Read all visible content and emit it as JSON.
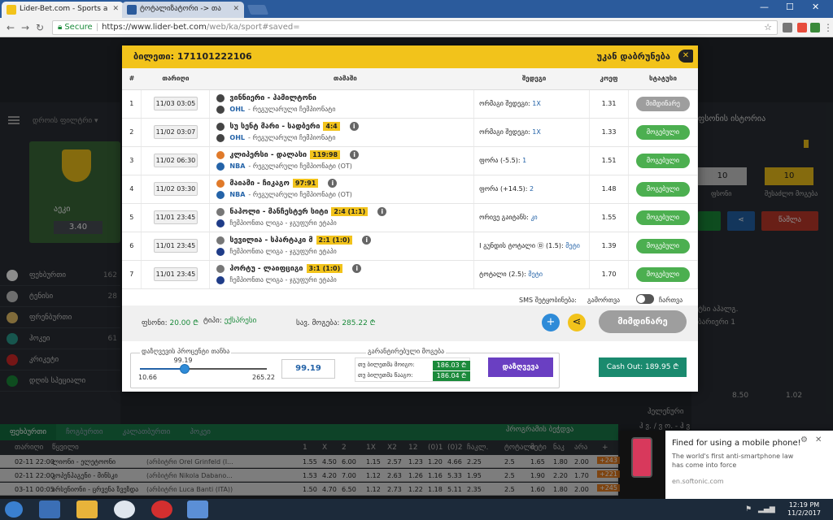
{
  "browser": {
    "tabs": [
      {
        "label": "Lider-Bet.com - Sports a",
        "favicon_color": "#f2c31b"
      },
      {
        "label": "ტოტალიზატორი -> თა",
        "favicon_color": "#2b5b9c"
      }
    ],
    "secure_label": "Secure",
    "url_domain": "https://www.lider-bet.com",
    "url_path": "/web/ka/sport#saved="
  },
  "colors": {
    "brand_yellow": "#f2c31b",
    "won_green": "#4caf50",
    "status_gray": "#9e9e9e",
    "calc_purple": "#6a3fc2",
    "cashout_teal": "#1a8a6e"
  },
  "background": {
    "filter_label": "დროის ფილტრი ▾",
    "promo_team": "აეკი",
    "promo_odd": "3.40",
    "sports": [
      {
        "name": "ფეხბურთი",
        "count": "162",
        "color": "#ffffff"
      },
      {
        "name": "ტენისი",
        "count": "28",
        "color": "#c8c8c8"
      },
      {
        "name": "ფრენბურთი",
        "count": "",
        "color": "#e9c46a"
      },
      {
        "name": "ჰოკეი",
        "count": "61",
        "color": "#2a9d8f"
      },
      {
        "name": "კრიკეტი",
        "count": "",
        "color": "#d62828"
      },
      {
        "name": "დღის სპეციალი",
        "count": "",
        "color": "#1a8a3a"
      }
    ],
    "right": {
      "title": "ფსონის ისტორია",
      "box1": "10",
      "box2": "10",
      "box1_label": "ფსონი",
      "box2_label": "შესაძლო მოგება",
      "delete_label": "წაშლა",
      "items": [
        "ტსი აჰალგ.",
        "ბარიერი 1",
        "ჰელენური",
        "ჰ ვ. / ვ ო. - ჰ ვ"
      ],
      "odds": [
        "8.50",
        "1.02"
      ]
    },
    "bottom_tabs": [
      {
        "label": "ფეხბურთი",
        "active": true
      },
      {
        "label": "ჩოგბურთი",
        "active": false
      },
      {
        "label": "კალათბურთი",
        "active": false
      },
      {
        "label": "ჰოკეი",
        "active": false
      }
    ],
    "program_label": "პროგრამის ბეჭდვა",
    "table_cols": [
      "თარიღი",
      "წყვილი",
      "1",
      "X",
      "2",
      "1X",
      "X2",
      "12",
      "(0)1",
      "(0)2",
      "ჩაკლ.",
      "ტოტალი",
      "მეტი",
      "ნაკ",
      "არა",
      "+"
    ],
    "rows": [
      {
        "date": "02-11 22:00",
        "pair": "ლიონი - ელეტოონი",
        "ref": "(არბიტრი Orel Grinfeld (I...",
        "odds": [
          "1.55",
          "4.50",
          "6.00",
          "1.15",
          "2.57",
          "1.23",
          "1.20",
          "4.66",
          "2.25",
          "2.5",
          "1.65",
          "1.80",
          "2.00"
        ],
        "more": "+243"
      },
      {
        "date": "02-11 22:00",
        "pair": "კოპენჰაგენი - მინსკი",
        "ref": "(არბიტრი Nikola Dabano...",
        "odds": [
          "1.53",
          "4.20",
          "7.00",
          "1.12",
          "2.63",
          "1.26",
          "1.16",
          "5.33",
          "1.95",
          "2.5",
          "1.90",
          "2.20",
          "1.70"
        ],
        "more": "+221"
      },
      {
        "date": "03-11 00:05",
        "pair": "არსენიონი - ცრვენა ზვეზდა",
        "ref": "(არბიტრი Luca Banti (ITA))",
        "odds": [
          "1.50",
          "4.70",
          "6.50",
          "1.12",
          "2.73",
          "1.22",
          "1.18",
          "5.11",
          "2.35",
          "2.5",
          "1.60",
          "1.80",
          "2.00"
        ],
        "more": "+245"
      }
    ]
  },
  "modal": {
    "ticket_label": "ბილეთი: 171101222106",
    "back_label": "უკან დაბრუნება",
    "columns": [
      "#",
      "თარიღი",
      "თამაში",
      "შედეგი",
      "კოეფ",
      "სტატუსი"
    ],
    "bets": [
      {
        "num": "1",
        "date": "11/03 03:05",
        "sport_color": "#444444",
        "teams": "ვინნიერი - ჰამილტონი",
        "score": "",
        "info": false,
        "league": "OHL",
        "league_color": "#444444",
        "tournament": "- რეგულარული ჩემპიონატი",
        "bet_label": "ორმაგი შედეგი:",
        "bet_value": "1X",
        "odd": "1.31",
        "status": "მიმდინარე",
        "status_type": "pending"
      },
      {
        "num": "2",
        "date": "11/02 03:07",
        "sport_color": "#444444",
        "teams": "სუ სენტ მარი - სადბერი",
        "score": "4:4",
        "info": true,
        "league": "OHL",
        "league_color": "#444444",
        "tournament": "- რეგულარული ჩემპიონატი",
        "bet_label": "ორმაგი შედეგი:",
        "bet_value": "1X",
        "odd": "1.33",
        "status": "მოგებული",
        "status_type": "won"
      },
      {
        "num": "3",
        "date": "11/02 06:30",
        "sport_color": "#e07a2a",
        "teams": "კლიპერსი - დალასი",
        "score": "119:98",
        "info": true,
        "league": "NBA",
        "league_color": "#2463a8",
        "tournament": "- რეგულარული ჩემპიონატი (OT)",
        "bet_label": "ფორა (-5.5):",
        "bet_value": "1",
        "odd": "1.51",
        "status": "მოგებული",
        "status_type": "won"
      },
      {
        "num": "4",
        "date": "11/02 03:30",
        "sport_color": "#e07a2a",
        "teams": "მაიამი - ჩიკაგო",
        "score": "97:91",
        "info": true,
        "league": "NBA",
        "league_color": "#2463a8",
        "tournament": "- რეგულარული ჩემპიონატი (OT)",
        "bet_label": "ფორა (+14.5):",
        "bet_value": "2",
        "odd": "1.48",
        "status": "მოგებული",
        "status_type": "won"
      },
      {
        "num": "5",
        "date": "11/01 23:45",
        "sport_color": "#777777",
        "teams": "ნაპოლი - მანჩესტერ სიტი",
        "score": "2:4 (1:1)",
        "info": true,
        "league": "",
        "league_color": "#1f3c88",
        "tournament": "ჩემპიონთა ლიგა - ჯგუფური ეტაპი",
        "bet_label": "ორივე გაიტანს:",
        "bet_value": "კი",
        "odd": "1.55",
        "status": "მოგებული",
        "status_type": "won"
      },
      {
        "num": "6",
        "date": "11/01 23:45",
        "sport_color": "#777777",
        "teams": "სევილია - სპარტაკი მ",
        "score": "2:1 (1:0)",
        "info": true,
        "league": "",
        "league_color": "#1f3c88",
        "tournament": "ჩემპიონთა ლიგა - ჯგუფური ეტაპი",
        "bet_label": "I გუნდის ტოტალი Ⓓ (1.5):",
        "bet_value": "მეტი",
        "odd": "1.39",
        "status": "მოგებული",
        "status_type": "won"
      },
      {
        "num": "7",
        "date": "11/01 23:45",
        "sport_color": "#777777",
        "teams": "პორტუ - ლაიფციგი",
        "score": "3:1 (1:0)",
        "info": true,
        "league": "",
        "league_color": "#1f3c88",
        "tournament": "ჩემპიონთა ლიგა - ჯგუფური ეტაპი",
        "bet_label": "ტოტალი (2.5):",
        "bet_value": "მეტი",
        "odd": "1.70",
        "status": "მოგებული",
        "status_type": "won"
      }
    ],
    "sms_label": "SMS შეტყობინება:",
    "sms_off": "გამორთვა",
    "sms_on": "ჩართვა",
    "stake_label": "ფსონი:",
    "stake_value": "20.00 ₾",
    "type_label": "ტიპი:",
    "type_value": "ექსპრესი",
    "total_label": "სავ. მოგება:",
    "total_value": "285.22 ₾",
    "status_big": "მიმდინარე",
    "calc_title": "დაზღვევის პროცენტი თანხა",
    "slider_value": "99.19",
    "slider_min": "10.66",
    "slider_max": "265.22",
    "slider_fraction": 0.35,
    "calc_input": "99.19",
    "guarantee_title": "გარანტირებული მოგება",
    "guarantee_win_label": "თუ ბილეთმა მოიგო:",
    "guarantee_win_value": "186.03 ₾",
    "guarantee_lose_label": "თუ ბილეთმა წააგო:",
    "guarantee_lose_value": "186.04 ₾",
    "insure_button": "დაზღვევა",
    "cashout_button": "Cash Out: 189.95 ₾"
  },
  "toast": {
    "title": "Fined for using a mobile phone!",
    "desc": "The world's first anti-smartphone law has come into force",
    "source": "en.softonic.com"
  },
  "taskbar": {
    "time": "12:19 PM",
    "date": "11/2/2017"
  }
}
